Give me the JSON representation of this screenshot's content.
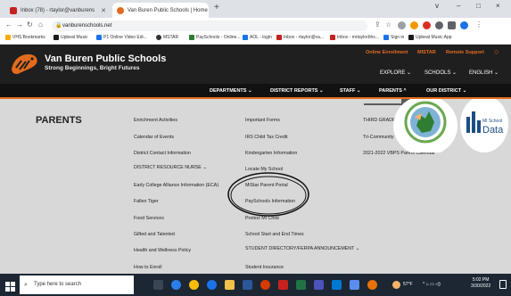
{
  "browser": {
    "tabs": [
      {
        "title": "Inbox (78) - rtaylor@vanburens",
        "active": false
      },
      {
        "title": "Van Buren Public Schools | Home",
        "active": true
      }
    ],
    "new_tab": "+",
    "url": "vanburenschools.net",
    "window_controls": [
      "v",
      "–",
      "□",
      "×"
    ],
    "bookmarks": [
      "VHS Bookmarks",
      "Upbeat Music",
      "P1 Online Video Edi...",
      "MSTAR",
      "PaySchools - Online...",
      "AOL - login",
      "Inbox - rtaylor@va...",
      "Inbox - mrtaylorbhs...",
      "Sign in",
      "Upbeat Music App"
    ]
  },
  "site": {
    "title": "Van Buren Public Schools",
    "tagline": "Strong Beginnings, Bright Futures",
    "top_links": [
      "Online Enrollment",
      "MISTAR",
      "Remote Support"
    ],
    "nav": [
      "EXPLORE",
      "SCHOOLS",
      "ENGLISH"
    ],
    "menu": [
      "DEPARTMENTS",
      "DISTRICT REPORTS",
      "STAFF",
      "PARENTS",
      "OUR DISTRICT"
    ]
  },
  "dropdown": {
    "heading": "PARENTS",
    "col1": [
      "Enrichment Activities",
      "Calendar of Events",
      "District Contact Information",
      "DISTRICT RESOURCE NURSE",
      "Early College Alliance Information (ECA)",
      "Fallen Tiger",
      "Food Services",
      "Gifted and Talented",
      "Health and Wellness Policy",
      "How to Enroll"
    ],
    "col2": [
      "Important Forms",
      "IRS Child Tax Credit",
      "Kindergarten Information",
      "Locate My School",
      "MiStar Parent Portal",
      "PaySchools Information",
      "Protect MI Child",
      "School Start and End Times",
      "STUDENT DIRECTORY/FERPA ANNOUNCEMENT",
      "Student Insurance"
    ],
    "col3": [
      "THIRD GRADE",
      "Tri-Community",
      "2021-2022 VBPS Parent Calendar"
    ],
    "badge_data": "Data",
    "badge_data_small": "MI School"
  },
  "taskbar": {
    "search_placeholder": "Type here to search",
    "weather": "57°F",
    "time": "5:02 PM",
    "date": "3/30/2022"
  }
}
